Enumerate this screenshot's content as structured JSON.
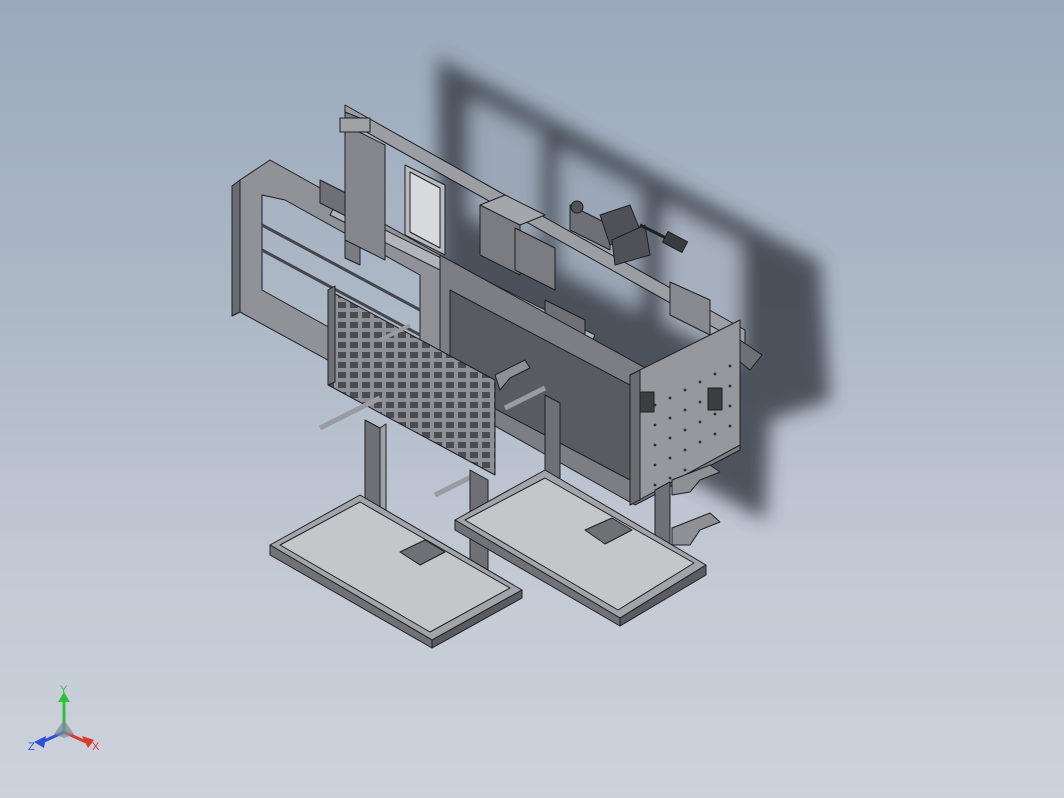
{
  "viewport": {
    "background_top": "#9aa9bc",
    "background_bottom": "#cdd2db",
    "shadow_color": "#3a3f48",
    "model_fill": "#8e9096",
    "model_dark": "#55575c",
    "model_edge": "#1e1f22"
  },
  "triad": {
    "y_label": "Y",
    "x_label": "X",
    "z_label": "Z",
    "y_color": "#2fbf3a",
    "x_color": "#d83a2e",
    "z_color": "#2f4fd8"
  }
}
